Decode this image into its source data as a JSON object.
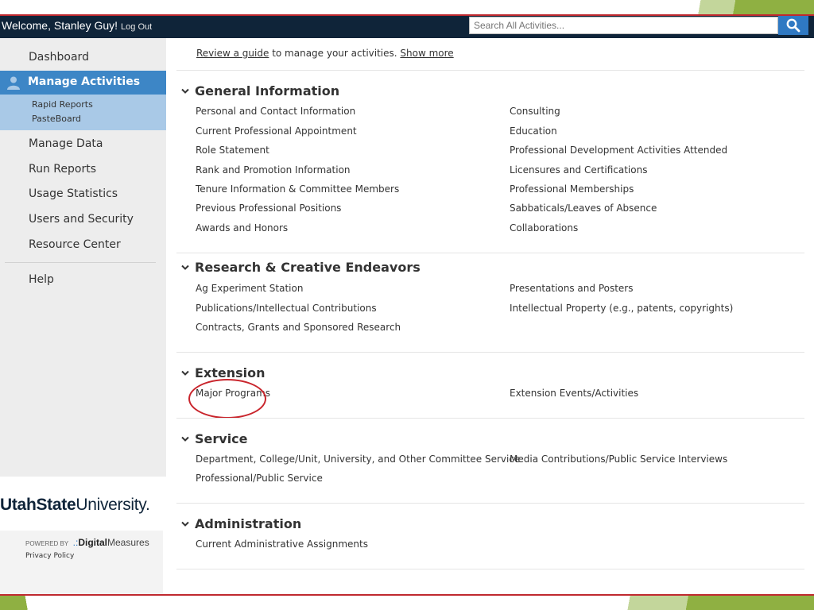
{
  "header": {
    "welcome": "Welcome, Stanley Guy!",
    "logout": "Log Out",
    "search_placeholder": "Search All Activities..."
  },
  "sidebar": {
    "dashboard": "Dashboard",
    "manage_activities": "Manage Activities",
    "sub": [
      "Rapid Reports",
      "PasteBoard"
    ],
    "manage_data": "Manage Data",
    "run_reports": "Run Reports",
    "usage_statistics": "Usage Statistics",
    "users_security": "Users and Security",
    "resource_center": "Resource Center",
    "help": "Help"
  },
  "branding": {
    "university_bold": "UtahState",
    "university_rest": "University.",
    "powered_by": "POWERED BY",
    "dm_bold": "Digital",
    "dm_rest": "Measures",
    "privacy": "Privacy Policy"
  },
  "intro": {
    "review_link": "Review a guide",
    "text": "to manage your activities.",
    "show_more": "Show more"
  },
  "sections": {
    "general": {
      "title": "General Information",
      "col1": [
        "Personal and Contact Information",
        "Current Professional Appointment",
        "Role Statement",
        "Rank and Promotion Information",
        "Tenure Information & Committee Members",
        "Previous Professional Positions",
        "Awards and Honors"
      ],
      "col2": [
        "Consulting",
        "Education",
        "Professional Development Activities Attended",
        "Licensures and Certifications",
        "Professional Memberships",
        "Sabbaticals/Leaves of Absence",
        "Collaborations"
      ]
    },
    "research": {
      "title": "Research & Creative Endeavors",
      "col1": [
        "Ag Experiment Station",
        "Publications/Intellectual Contributions",
        "Contracts, Grants and Sponsored Research"
      ],
      "col2": [
        "Presentations and Posters",
        "Intellectual Property (e.g., patents, copyrights)"
      ]
    },
    "extension": {
      "title": "Extension",
      "col1": [
        "Major Programs"
      ],
      "col2": [
        "Extension Events/Activities"
      ]
    },
    "service": {
      "title": "Service",
      "col1": [
        "Department, College/Unit, University, and Other Committee Service",
        "Professional/Public Service"
      ],
      "col2": [
        "Media Contributions/Public Service Interviews"
      ]
    },
    "administration": {
      "title": "Administration",
      "col1": [
        "Current Administrative Assignments"
      ]
    }
  },
  "colors": {
    "topbar": "#0f2439",
    "active_nav": "#3d86c6",
    "subnav": "#a9c9e7",
    "search_button": "#2f79c3",
    "annotation": "#c9252c",
    "accent_green": "#8fb042"
  },
  "icons": [
    "search-icon",
    "user-icon",
    "chevron-down-icon"
  ]
}
